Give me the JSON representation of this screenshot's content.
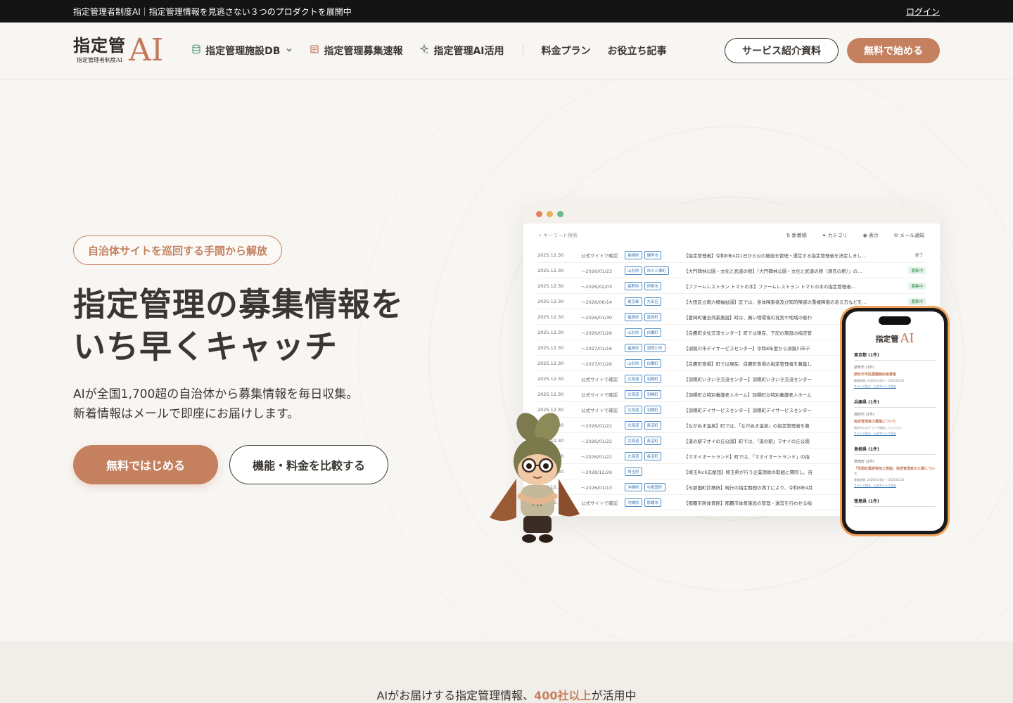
{
  "topbar": {
    "announcement": "指定管理者制度AI｜指定管理情報を見逃さない３つのプロダクトを展開中",
    "login": "ログイン"
  },
  "header": {
    "logo_main": "指定管",
    "logo_ai": "AI",
    "logo_sub": "指定管理者制度AI",
    "nav": [
      {
        "label": "指定管理施設DB",
        "icon": "database-icon"
      },
      {
        "label": "指定管理募集速報",
        "icon": "newspaper-icon"
      },
      {
        "label": "指定管理AI活用",
        "icon": "sparkle-icon"
      },
      {
        "label": "料金プラン"
      },
      {
        "label": "お役立ち記事"
      }
    ],
    "btn_docs": "サービス紹介資料",
    "btn_start": "無料で始める"
  },
  "hero": {
    "badge": "自治体サイトを巡回する手間から解放",
    "title_line1": "指定管理の募集情報を",
    "title_line2": "いち早くキャッチ",
    "desc_line1": "AIが全国1,700超の自治体から募集情報を毎日収集。",
    "desc_line2": "新着情報はメールで即座にお届けします。",
    "cta_primary": "無料ではじめる",
    "cta_secondary": "機能・料金を比較する"
  },
  "mock": {
    "search_placeholder": "キーワード検索",
    "tools": [
      "新着順",
      "カテゴリ",
      "表示",
      "メール通知"
    ],
    "rows": [
      {
        "date": "2025.12.30",
        "period": "公式サイトで確認",
        "pref": "長崎県",
        "city": "諫早市",
        "title": "【指定管理者】令和8年4月1日から公の施設を管理・運営する指定管理者を決定しまし…",
        "status": "終了",
        "open": false
      },
      {
        "date": "2025.12.30",
        "period": "〜2026/01/23",
        "pref": "山形県",
        "city": "市川三郷町",
        "title": "【大門碑林公園・文化と武道の館】「大門碑林公園・文化と武道の館（源氏の館）」の…",
        "status": "募集中",
        "open": true
      },
      {
        "date": "2025.12.30",
        "period": "〜2026/02/03",
        "pref": "長野県",
        "city": "伊那市",
        "title": "【ファームレストラン トマトの木】ファームレストラン トマトの木の指定管理者…",
        "status": "募集中",
        "open": true
      },
      {
        "date": "2025.12.30",
        "period": "〜2026/06/14",
        "pref": "東京都",
        "city": "大田区",
        "title": "【大田区立南六郷福祉園】区では、身体障害者及び知的障害の重複障害のある方などを…",
        "status": "募集中",
        "open": true
      },
      {
        "date": "2025.12.30",
        "period": "〜2026/01/30",
        "pref": "福島県",
        "city": "富岡町",
        "title": "【富岡町複合商業施設】町は、買い物環境の充実や地域の賑わ",
        "status": "",
        "open": true
      },
      {
        "date": "2025.12.30",
        "period": "〜2026/01/26",
        "pref": "山形県",
        "city": "白鷹町",
        "title": "【白鷹町文化交流センター】町では現在、下記の施設の指定管",
        "status": "",
        "open": true
      },
      {
        "date": "2025.12.30",
        "period": "〜2027/01/16",
        "pref": "福島県",
        "city": "須賀川市",
        "title": "【須賀川市デイサービスセンター】令和8年度から須賀川市デ",
        "status": "",
        "open": true
      },
      {
        "date": "2025.12.30",
        "period": "〜2027/01/26",
        "pref": "山形県",
        "city": "白鷹町",
        "title": "【白鷹町斎場】町では現在、白鷹町斎場の指定管理者を募集し",
        "status": "",
        "open": true
      },
      {
        "date": "2025.12.30",
        "period": "公式サイトで確認",
        "pref": "北海道",
        "city": "羽幌町",
        "title": "【羽幌町いきいき交流センター】羽幌町いきいき交流センター",
        "status": "",
        "open": true
      },
      {
        "date": "2025.12.30",
        "period": "公式サイトで確認",
        "pref": "北海道",
        "city": "羽幌町",
        "title": "【羽幌町立特別養護老人ホーム】羽幌町立特別養護老人ホーム",
        "status": "",
        "open": true
      },
      {
        "date": "2025.12.30",
        "period": "公式サイトで確認",
        "pref": "北海道",
        "city": "羽幌町",
        "title": "【羽幌町デイサービスセンター】羽幌町デイサービスセンター",
        "status": "",
        "open": true
      },
      {
        "date": "2025.12.30",
        "period": "〜2026/01/22",
        "pref": "北海道",
        "city": "長沼町",
        "title": "【ながぬま温泉】町では、「ながぬま温泉」の指定管理者を募",
        "status": "",
        "open": true
      },
      {
        "date": "2025.12.30",
        "period": "〜2026/01/22",
        "pref": "北海道",
        "city": "長沼町",
        "title": "【道の駅マオイの丘公園】町では、「道の駅」マオイの丘公園",
        "status": "",
        "open": true
      },
      {
        "date": "2025.12.30",
        "period": "〜2026/01/22",
        "pref": "北海道",
        "city": "長沼町",
        "title": "【マオイオートランド】町では、「マオイオートランド」の指",
        "status": "",
        "open": true
      },
      {
        "date": "2025.12.30",
        "period": "〜2028/12/26",
        "pref": "埼玉県",
        "city": "",
        "title": "【埼玉Rich応援団】埼玉県が行う企業誘致の取組に賛同し、自",
        "status": "",
        "open": true
      },
      {
        "date": "2025.12.30",
        "period": "〜2026/01/13",
        "pref": "沖縄県",
        "city": "与那国町",
        "title": "【与那国町診療所】現行の指定期間の満了により、令和8年4月",
        "status": "",
        "open": true
      },
      {
        "date": "2025.12.30",
        "period": "公式サイトで確認",
        "pref": "沖縄県",
        "city": "那覇市",
        "title": "【那覇市民体育館】那覇市体育施設の管理・運営を行わせる指",
        "status": "",
        "open": true
      }
    ]
  },
  "phone": {
    "logo_main": "指定管",
    "logo_ai": "AI",
    "sections": [
      {
        "pref": "東京都 (1件)",
        "city": "調布市 (1件)",
        "link": "調布市市民農園解約者募集",
        "meta": "募集期間: 2026/01/26 〜 2026/01/30",
        "actions": "サイトで見る　公式サイトで見る"
      },
      {
        "pref": "兵庫県 (1件)",
        "city": "高砂市 (1件)",
        "link": "指定管理者の募集について",
        "meta": "高砂市公式サイトで確認してください",
        "actions": "サイトで見る　公式サイトで見る"
      },
      {
        "pref": "島根県 (1件)",
        "city": "邑南町 (1件)",
        "link": "「邑南町農産物加工施設」指定管理者の公募について",
        "meta": "募集期間: 2026/01/06 〜 2026/01/30",
        "actions": "サイトで見る　公式サイトで見る"
      },
      {
        "pref": "徳島県 (1件)",
        "city": "",
        "link": "",
        "meta": "",
        "actions": ""
      }
    ]
  },
  "band": {
    "text_before": "AIがお届けする指定管理情報、",
    "highlight": "400社以上",
    "text_after": "が活用中"
  },
  "colors": {
    "accent": "#c4805f",
    "dark": "#141414",
    "background": "#f8f6f3",
    "tag_blue": "#3c78b4",
    "status_green": "#2e8a4e"
  }
}
